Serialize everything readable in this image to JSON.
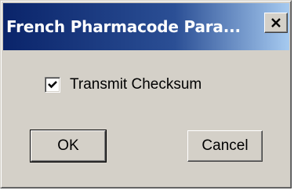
{
  "window": {
    "title": "French Pharmacode Para...",
    "close_icon": "close-x-icon"
  },
  "options": {
    "transmit_checksum": {
      "label": "Transmit Checksum",
      "checked": true
    }
  },
  "buttons": {
    "ok_label": "OK",
    "cancel_label": "Cancel"
  },
  "colors": {
    "titlebar_start": "#0a246a",
    "titlebar_end": "#a6caf0",
    "face": "#d4d0c8"
  }
}
